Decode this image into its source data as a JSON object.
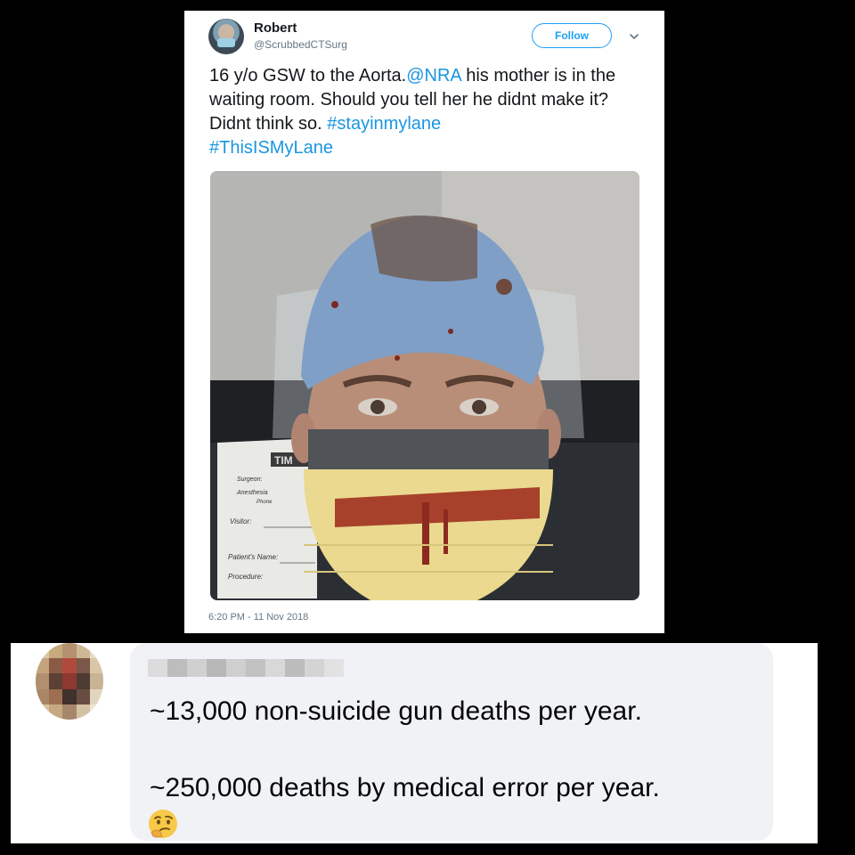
{
  "tweet": {
    "author_name": "Robert",
    "author_handle": "@ScrubbedCTSurg",
    "follow_label": "Follow",
    "text_part1": "16 y/o GSW to the Aorta.",
    "mention": "@NRA",
    "text_part2": " his mother is in the waiting room. Should you tell her he didnt make it? Didnt think so. ",
    "hashtag1": "#stayinmylane",
    "hashtag2": "#ThisISMyLane",
    "timestamp": "6:20 PM - 11 Nov 2018",
    "photo": {
      "board_label": "TIM",
      "form_fields": [
        "Surgeon:",
        "Anesthesia",
        "Phone",
        "Visitor:",
        "Patient's Name:",
        "Procedure:"
      ]
    },
    "colors": {
      "link": "#1b95e0",
      "follow": "#1da1f2"
    }
  },
  "comment": {
    "line1": "~13,000 non-suicide gun deaths per year.",
    "line2": "~250,000 deaths by medical error per year.",
    "emoji": "thinking-face-icon"
  }
}
